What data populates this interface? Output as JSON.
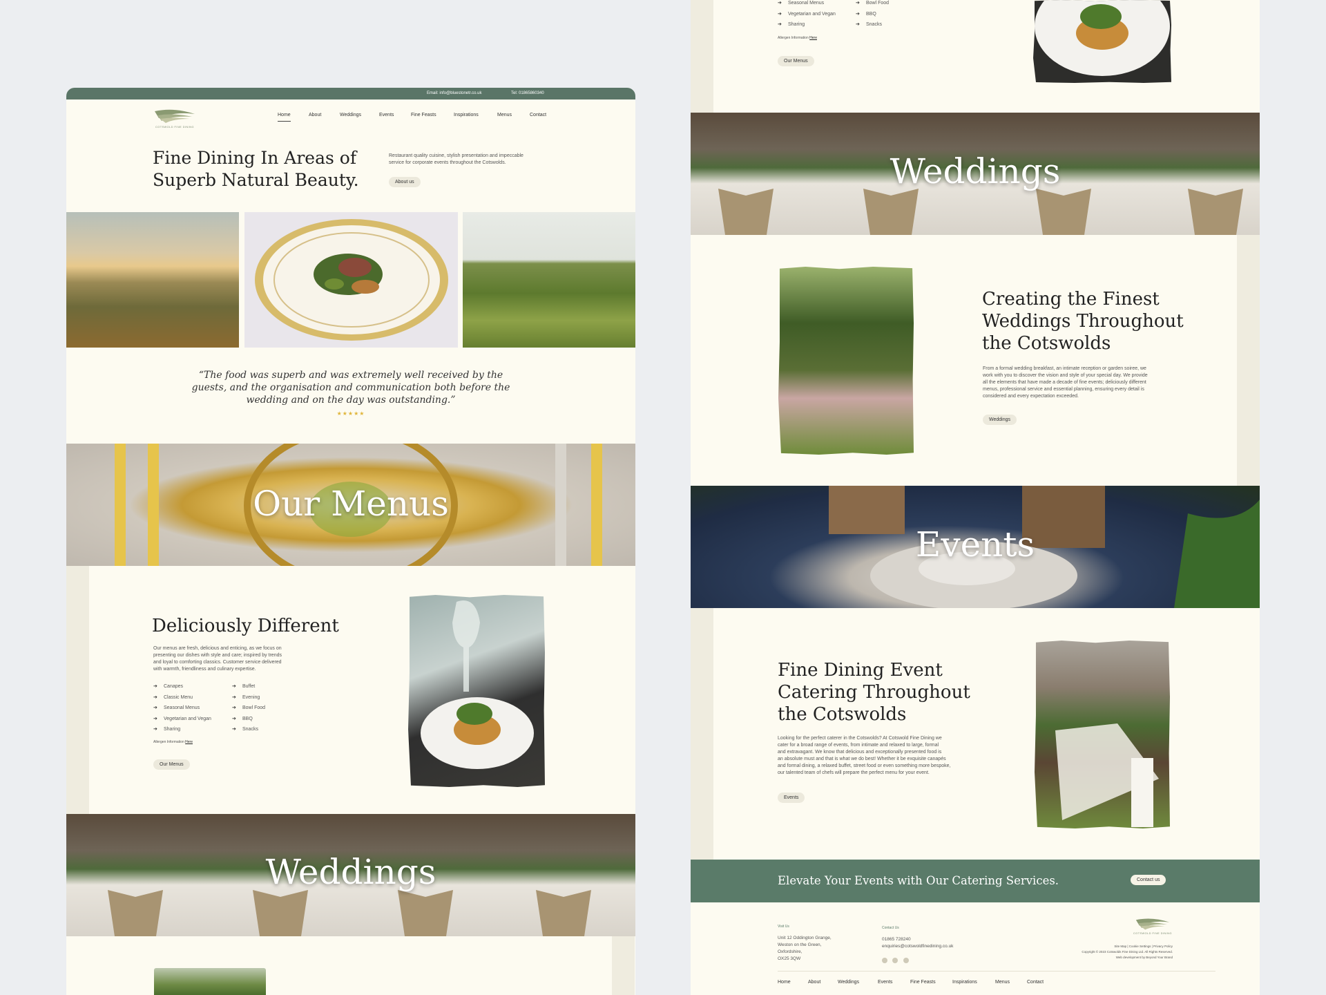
{
  "brand": {
    "logo_text": "COTSWOLD FINE DINING"
  },
  "topbar": {
    "email": "Email: info@bluestonetr.co.uk",
    "tel": "Tel: 01865860340"
  },
  "nav": [
    "Home",
    "About",
    "Weddings",
    "Events",
    "Fine Feasts",
    "Inspirations",
    "Menus",
    "Contact"
  ],
  "hero": {
    "line1": "Fine Dining In Areas of",
    "line2": "Superb Natural Beauty.",
    "desc1": "Restaurant quality cuisine, stylish presentation and impeccable",
    "desc2": "service for corporate events throughout the Cotswolds.",
    "button": "About us"
  },
  "testimonial": {
    "line1": "“The food was superb and was extremely well received by the",
    "line2": "guests, and the organisation and communication both before the",
    "line3": "wedding and on the day was outstanding.”",
    "rating": 5,
    "stars": "★★★★★"
  },
  "menus_banner": {
    "title": "Our Menus"
  },
  "menus": {
    "heading": "Deliciously Different",
    "body1": "Our menus are fresh, delicious and enticing, as we focus on",
    "body2": "presenting our dishes with style and care; inspired by trends",
    "body3": "and loyal to comforting classics. Customer service delivered",
    "body4": "with warmth, friendliness and culinary expertise.",
    "list_left": [
      "Canapes",
      "Classic Menu",
      "Seasonal Menus",
      "Vegetarian and Vegan",
      "Sharing"
    ],
    "list_right": [
      "Buffet",
      "Evening",
      "Bowl Food",
      "BBQ",
      "Snacks"
    ],
    "allergen_label": "Allergen Information",
    "allergen_link": "Here",
    "button": "Our Menus"
  },
  "weddings_banner": {
    "title": "Weddings"
  },
  "weddings": {
    "heading1": "Creating the Finest",
    "heading2": "Weddings Throughout",
    "heading3": "the Cotswolds",
    "body1": "From a formal wedding breakfast, an intimate reception or garden soiree, we",
    "body2": "work with you to discover the vision and style of your special day. We provide",
    "body3": "all the elements that have made a decade of fine events; deliciously different",
    "body4": "menus, professional service and essential planning, ensuring every detail is",
    "body5": "considered and every expectation exceeded.",
    "button": "Weddings"
  },
  "events_banner": {
    "title": "Events"
  },
  "events": {
    "heading1": "Fine Dining Event",
    "heading2": "Catering Throughout",
    "heading3": "the Cotswolds",
    "body1": "Looking for the perfect caterer in the Cotswolds? At Cotswold Fine Dining we",
    "body2": "cater for a broad range of events, from intimate and relaxed to large, formal",
    "body3": "and extravagant. We know that delicious and exceptionally presented food is",
    "body4": "an absolute must and that is what we do best! Whether it be exquisite canapés",
    "body5": "and formal dining, a relaxed buffet, street food or even something more bespoke,",
    "body6": "our talented team of chefs will prepare the perfect menu for your event.",
    "button": "Events"
  },
  "cta": {
    "text": "Elevate Your Events with Our Catering Services.",
    "button": "Contact us"
  },
  "footer": {
    "visit_label": "Visit Us",
    "address": [
      "Unit 12 Oddington Grange,",
      "Weston on the Green,",
      "Oxfordshire,",
      "OX25 3QW"
    ],
    "contact_label": "Contact Us",
    "phone": "01865 728240",
    "email": "enquiries@cotswoldfinedining.co.uk",
    "links": "Site Map  |  Cookie Settings  |  Privacy Policy",
    "copyright": "Copyright © 2023 Cotswolds Fine Dining Ltd. All Rights Reserved.",
    "credit": "Web development by Beyond Your Brand",
    "nav": [
      "Home",
      "About",
      "Weddings",
      "Events",
      "Fine Feasts",
      "Inspirations",
      "Menus",
      "Contact"
    ]
  },
  "colors": {
    "topbar": "#5a7567",
    "cream": "#fdfbf1",
    "cta_green": "#5a7b69",
    "pill": "#ece9dc",
    "star": "#e0b53a"
  }
}
